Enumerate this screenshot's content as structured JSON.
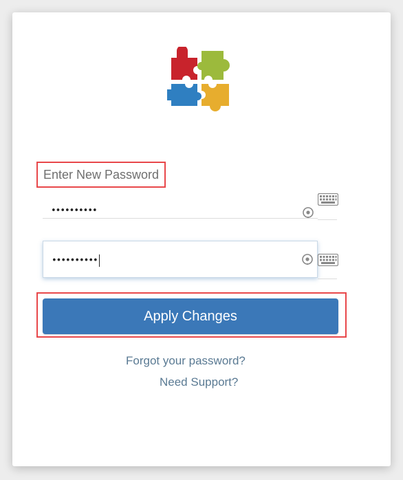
{
  "form": {
    "label": "Enter New Password",
    "password_value": "••••••••••",
    "confirm_value": "••••••••••",
    "apply_label": "Apply Changes"
  },
  "links": {
    "forgot": "Forgot your password?",
    "support": "Need Support?"
  },
  "icons": {
    "reveal": "eye-icon",
    "keyboard": "keyboard-icon",
    "logo": "puzzle-logo"
  },
  "colors": {
    "primary": "#3b78b8",
    "highlight": "#e8474a",
    "link": "#5a7a93",
    "logo_red": "#c8232c",
    "logo_green": "#9cba3c",
    "logo_blue": "#2f7fc1",
    "logo_yellow": "#e7ad2e"
  }
}
